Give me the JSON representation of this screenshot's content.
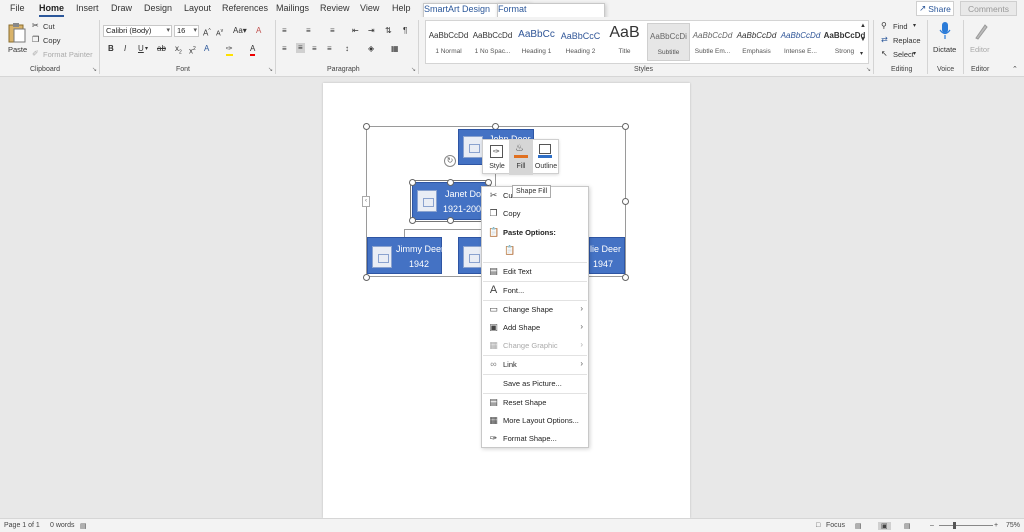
{
  "menu": {
    "tabs": [
      "File",
      "Home",
      "Insert",
      "Draw",
      "Design",
      "Layout",
      "References",
      "Mailings",
      "Review",
      "View",
      "Help",
      "SmartArt Design",
      "Format"
    ],
    "active_tab": "Home",
    "share_label": "Share",
    "comments_label": "Comments"
  },
  "ribbon": {
    "clipboard": {
      "label": "Clipboard",
      "paste": "Paste",
      "cut": "Cut",
      "copy": "Copy",
      "format_painter": "Format Painter"
    },
    "font": {
      "label": "Font",
      "font_name": "Calibri (Body)",
      "font_size": "16",
      "case_label": "Aa"
    },
    "paragraph": {
      "label": "Paragraph"
    },
    "styles": {
      "label": "Styles",
      "items": [
        {
          "sample": "AaBbCcDd",
          "name": "1 Normal"
        },
        {
          "sample": "AaBbCcDd",
          "name": "1 No Spac..."
        },
        {
          "sample": "AaBbCc",
          "name": "Heading 1"
        },
        {
          "sample": "AaBbCcC",
          "name": "Heading 2"
        },
        {
          "sample": "AaB",
          "name": "Title"
        },
        {
          "sample": "AaBbCcDi",
          "name": "Subtitle"
        },
        {
          "sample": "AaBbCcDd",
          "name": "Subtle Em..."
        },
        {
          "sample": "AaBbCcDd",
          "name": "Emphasis"
        },
        {
          "sample": "AaBbCcDd",
          "name": "Intense E..."
        },
        {
          "sample": "AaBbCcDd",
          "name": "Strong"
        }
      ]
    },
    "editing": {
      "label": "Editing",
      "find": "Find",
      "replace": "Replace",
      "select": "Select"
    },
    "voice": {
      "label": "Voice",
      "dictate": "Dictate"
    },
    "editor": {
      "label": "Editor",
      "editor_btn": "Editor"
    }
  },
  "smartart": {
    "top_name": "John Deer",
    "mid_name": "Janet Doe",
    "mid_years": "1921-200",
    "left_name": "Jimmy Deer",
    "left_year": "1942",
    "right_name": "lie Deer",
    "right_year": "1947"
  },
  "mini_toolbar": {
    "style": "Style",
    "fill": "Fill",
    "outline": "Outline",
    "tooltip": "Shape Fill"
  },
  "context_menu": {
    "cut": "Cut",
    "copy": "Copy",
    "paste_options": "Paste Options:",
    "edit_text": "Edit Text",
    "font": "Font...",
    "change_shape": "Change Shape",
    "add_shape": "Add Shape",
    "change_graphic": "Change Graphic",
    "link": "Link",
    "save_as_picture": "Save as Picture...",
    "reset_shape": "Reset Shape",
    "more_layout": "More Layout Options...",
    "format_shape": "Format Shape..."
  },
  "status": {
    "page": "Page 1 of 1",
    "words": "0 words",
    "focus": "Focus",
    "zoom": "75%"
  }
}
